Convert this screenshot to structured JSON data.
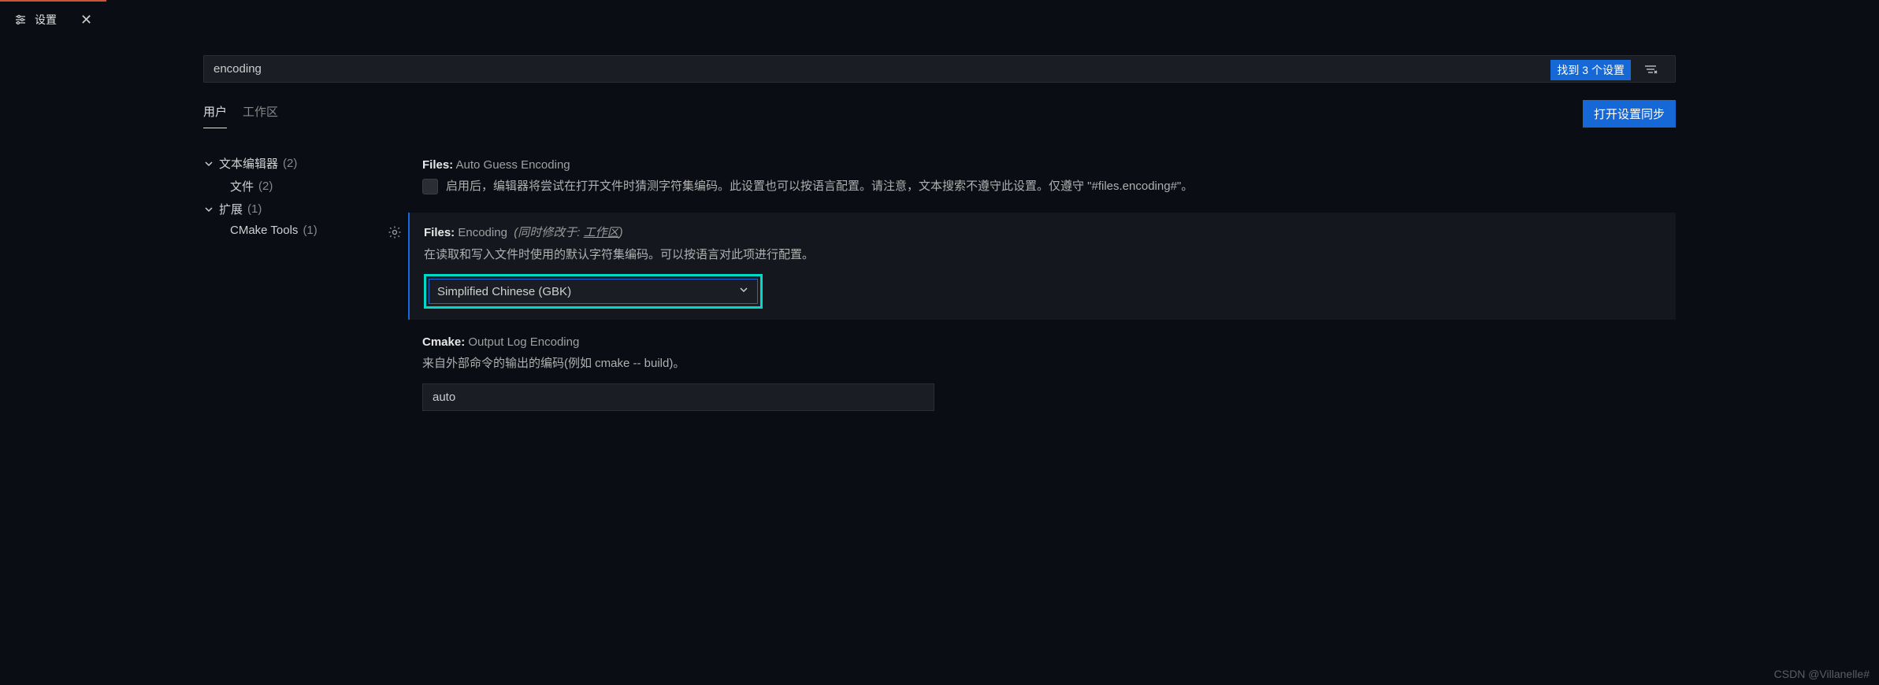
{
  "tab": {
    "title": "设置",
    "close_label": "✕"
  },
  "search": {
    "value": "encoding",
    "found_label": "找到 3 个设置"
  },
  "scope": {
    "user": "用户",
    "workspace": "工作区",
    "sync_button": "打开设置同步"
  },
  "tree": {
    "text_editor": {
      "label": "文本编辑器",
      "count": "(2)"
    },
    "files": {
      "label": "文件",
      "count": "(2)"
    },
    "extensions": {
      "label": "扩展",
      "count": "(1)"
    },
    "cmake_tools": {
      "label": "CMake Tools",
      "count": "(1)"
    }
  },
  "settings": {
    "auto_guess": {
      "prefix": "Files:",
      "suffix": "Auto Guess Encoding",
      "desc": "启用后，编辑器将尝试在打开文件时猜测字符集编码。此设置也可以按语言配置。请注意，文本搜索不遵守此设置。仅遵守 \"#files.encoding#\"。"
    },
    "encoding": {
      "prefix": "Files:",
      "suffix": "Encoding",
      "meta_prefix": "(同时修改于:",
      "meta_link": "工作区",
      "meta_suffix": ")",
      "desc": "在读取和写入文件时使用的默认字符集编码。可以按语言对此项进行配置。",
      "value": "Simplified Chinese (GBK)"
    },
    "cmake_log": {
      "prefix": "Cmake:",
      "suffix": "Output Log Encoding",
      "desc": "来自外部命令的输出的编码(例如 cmake -- build)。",
      "value": "auto"
    }
  },
  "watermark": "CSDN @Villanelle#"
}
